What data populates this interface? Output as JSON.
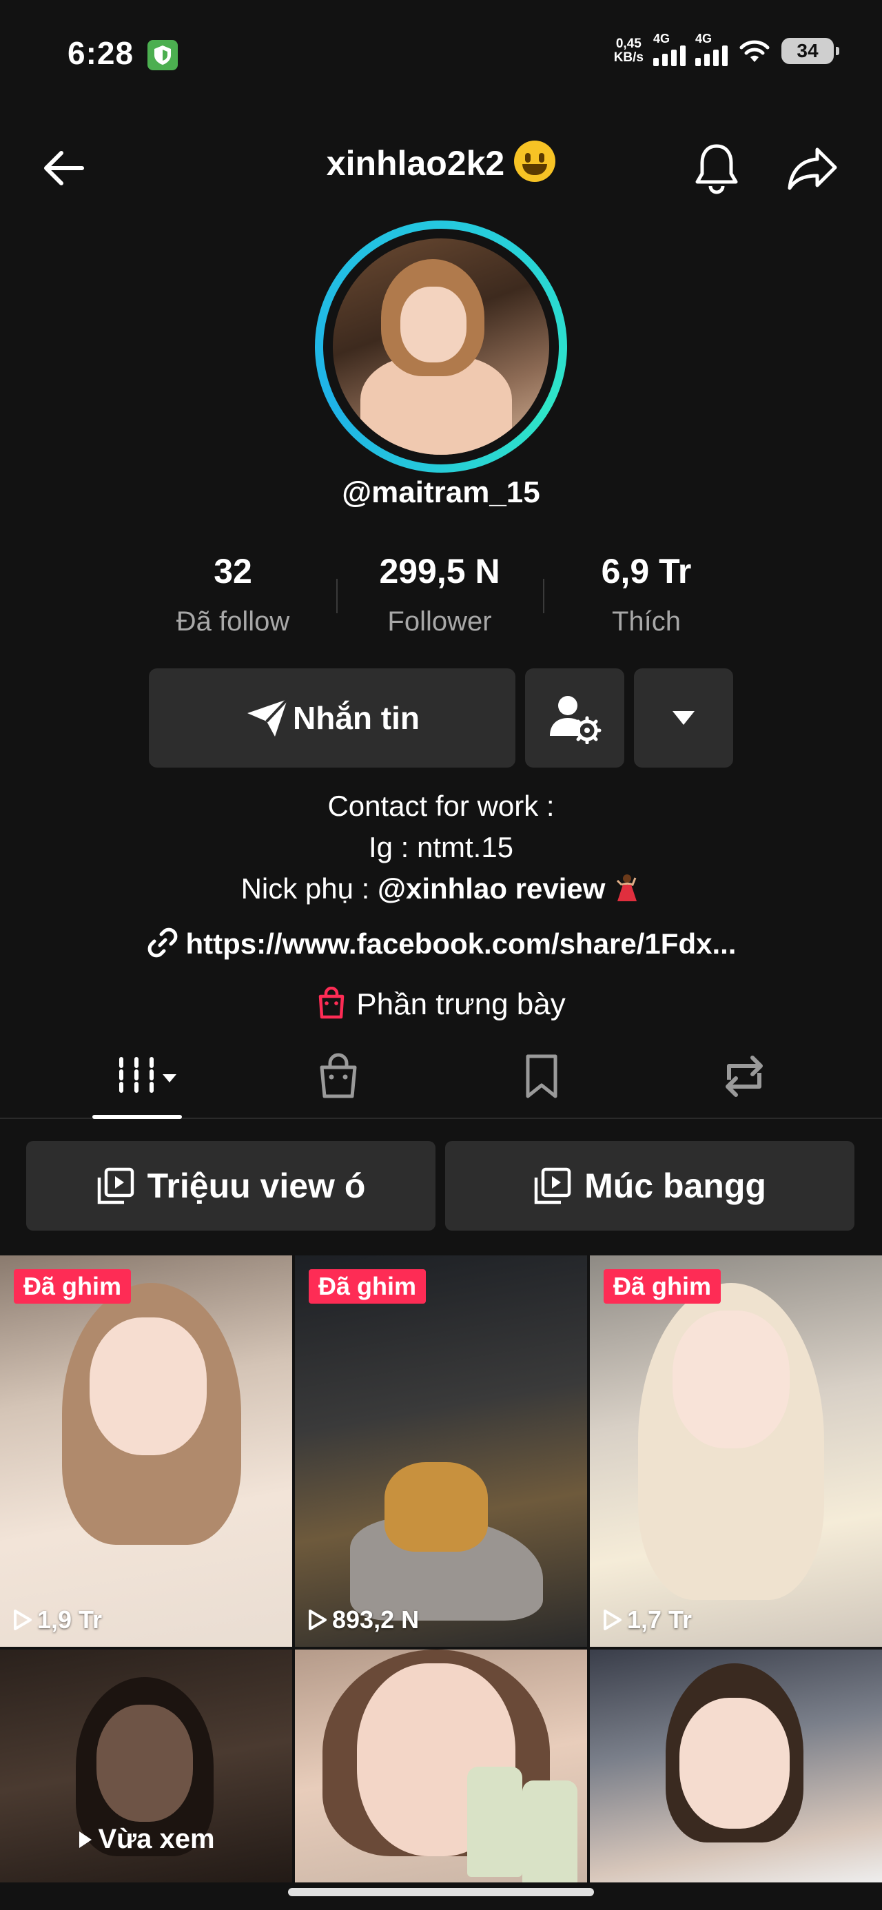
{
  "status_bar": {
    "time": "6:28",
    "net_speed_value": "0,45",
    "net_speed_unit": "KB/s",
    "signal_1_label": "4G",
    "signal_2_label": "4G",
    "battery": "34"
  },
  "header": {
    "title": "xinhlao2k2"
  },
  "profile": {
    "username": "@maitram_15",
    "stats": [
      {
        "value": "32",
        "label": "Đã follow"
      },
      {
        "value": "299,5 N",
        "label": "Follower"
      },
      {
        "value": "6,9 Tr",
        "label": "Thích"
      }
    ]
  },
  "actions": {
    "message_label": "Nhắn tin"
  },
  "bio": {
    "line1": "Contact for work :",
    "line2": "Ig : ntmt.15",
    "line3_prefix": "Nick phụ : ",
    "line3_handle": "@xinhlao review"
  },
  "link": "https://www.facebook.com/share/1Fdx...",
  "showcase_label": "Phần trưng bày",
  "playlists": [
    {
      "label": "Triệuu view ó"
    },
    {
      "label": "Múc bangg"
    }
  ],
  "videos": [
    {
      "pinned_label": "Đã ghim",
      "views": "1,9 Tr"
    },
    {
      "pinned_label": "Đã ghim",
      "views": "893,2 N"
    },
    {
      "pinned_label": "Đã ghim",
      "views": "1,7 Tr"
    },
    {
      "overlay": "Vừa xem"
    },
    {},
    {}
  ],
  "colors": {
    "background": "#121212",
    "button_bg": "#2d2d2d",
    "pinned_badge": "#fe2c55",
    "avatar_ring": "#25c8e0",
    "secondary_text": "#a8a8a8"
  },
  "icons": [
    "back-arrow-icon",
    "bell-icon",
    "share-icon",
    "send-icon",
    "person-settings-icon",
    "caret-down-icon",
    "link-icon",
    "shopping-bag-icon",
    "grid-icon",
    "bookmark-icon",
    "repost-icon",
    "playlist-icon",
    "play-icon"
  ]
}
